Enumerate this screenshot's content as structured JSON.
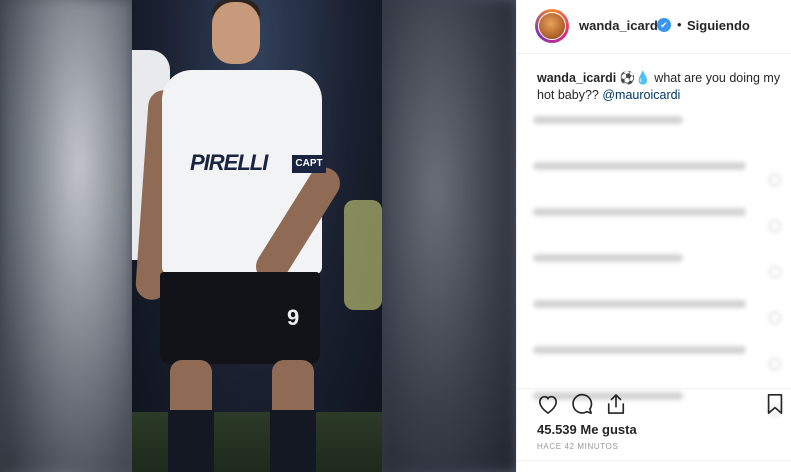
{
  "post": {
    "sponsor_text": "PIRELLI",
    "armband_text": "CAPT",
    "shirt_number": "9"
  },
  "header": {
    "username": "wanda_icardi",
    "verified_mark": "✔",
    "separator": "•",
    "follow_status": "Siguiendo"
  },
  "caption": {
    "username": "wanda_icardi",
    "emojis": "⚽💧",
    "text": " what are you doing my hot baby?? ",
    "mention": "@mauroicardi"
  },
  "actions": {
    "icons": [
      "heart-icon",
      "comment-icon",
      "share-icon",
      "bookmark-icon"
    ]
  },
  "stats": {
    "likes": "45.539 Me gusta",
    "time_ago": "HACE 42 MINUTOS"
  },
  "colors": {
    "link": "#003569",
    "verified": "#3897f0",
    "text": "#262626",
    "muted": "#999999"
  }
}
